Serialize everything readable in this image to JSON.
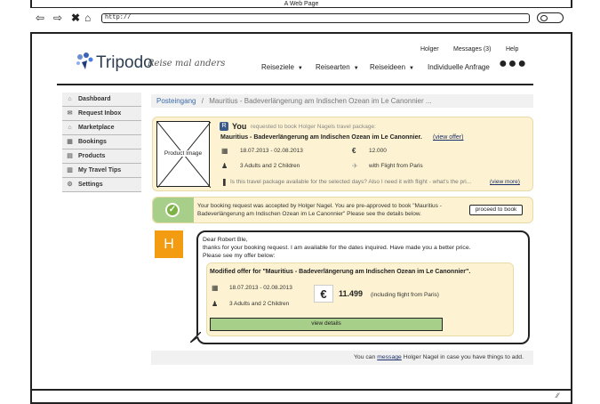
{
  "window": {
    "title": "A Web Page",
    "url": "http://"
  },
  "brand": {
    "name": "Tripodo",
    "tagline": "Reise mal anders"
  },
  "toplinks": {
    "user": "Holger",
    "messages": "Messages (3)",
    "help": "Help"
  },
  "menu": [
    "Reiseziele",
    "Reisearten",
    "Reiseideen",
    "Individuelle Anfrage"
  ],
  "sidebar": [
    "Dashboard",
    "Request Inbox",
    "Marketplace",
    "Bookings",
    "Products",
    "My Travel Tips",
    "Settings"
  ],
  "breadcrumb": {
    "root": "Posteingang",
    "sep": "/",
    "current": "Mauritius - Badeverlängerung am Indischen Ozean im Le Canonnier ..."
  },
  "request": {
    "image_label": "Product Image",
    "badge": "R",
    "you": "You",
    "you_text": "requested to book Holger Nagels travel package:",
    "title": "Mauritius - Badeverlängerung am Indischen Ozean im Le Canonnier.",
    "view_offer": "(view offer)",
    "dates": "18.07.2013 - 02.08.2013",
    "price": "12.000",
    "guests": "3 Adults and 2 Children",
    "flight": "with Flight from Paris",
    "question": "Is this travel package available for the selected days? Also I need it with flight - what's the pri...",
    "view_more": "(view more)"
  },
  "accepted": {
    "text": "Your booking request was accepted by Holger Nagel. You are pre-approved to book \"Mauritius - Badeverlängerung am Indischen Ozean im Le Canonnier\" Please see the details below.",
    "button": "proceed to book"
  },
  "message": {
    "avatar": "H",
    "greeting": "Dear Robert Ble,",
    "body": "thanks for your booking request. I am available for the dates inquired. Have made you a better price.",
    "body2": "Please see my offer below:",
    "modified_title": "Modified offer for \"Mauritius - Badeverlängerung am Indischen Ozean im Le Canonnier\".",
    "dates": "18.07.2013 - 02.08.2013",
    "guests": "3 Adults and 2 Children",
    "currency": "€",
    "price": "11.499",
    "price_note": "(including flight from Paris)",
    "view_details": "view details"
  },
  "footer": {
    "pre": "You can",
    "link": "message",
    "post": "Holger Nagel in case you have things to add."
  }
}
